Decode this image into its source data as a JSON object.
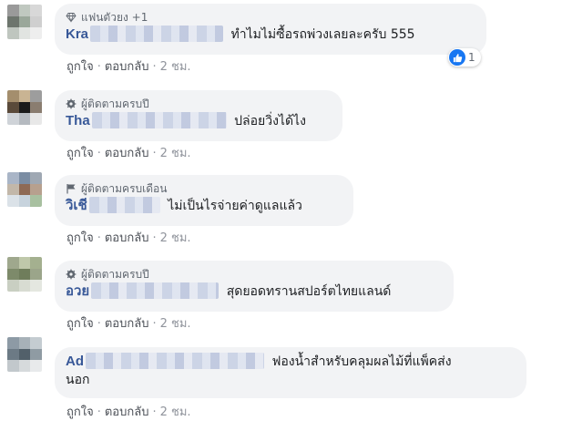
{
  "colors": {
    "author_link": "#385898",
    "bubble_bg": "#f2f3f5",
    "secondary_text": "#606770",
    "like_blue": "#1877f2"
  },
  "comments": [
    {
      "badge_icon": "diamond-icon",
      "badge_text": "แฟนตัวยง +1",
      "author_visible": "Kra",
      "body": "ทำไมไม่ซื้อรถพ่วงเลยละครับ 555",
      "actions": {
        "like": "ถูกใจ",
        "reply": "ตอบกลับ",
        "time": "2 ชม."
      },
      "reaction": {
        "icon": "like-icon",
        "count": "1"
      },
      "avatar_colors": [
        "#9a9a9a",
        "#c0c8c0",
        "#d8d8d8",
        "#6d756d",
        "#9aa79a",
        "#cfcfcf",
        "#bfc6bf",
        "#e1e4e1",
        "#eeeeee"
      ]
    },
    {
      "badge_icon": "gear-icon",
      "badge_text": "ผู้ติดตามครบปี",
      "author_visible": "Tha",
      "body": "ปล่อยวิ่งได้ไง",
      "actions": {
        "like": "ถูกใจ",
        "reply": "ตอบกลับ",
        "time": "2 ชม."
      },
      "avatar_colors": [
        "#a48e6d",
        "#c9b493",
        "#9d9d9d",
        "#5a4a3a",
        "#1a1a1a",
        "#8a7d70",
        "#cfd3d8",
        "#b5bac0",
        "#e8e8e8"
      ]
    },
    {
      "badge_icon": "flag-icon",
      "badge_text": "ผู้ติดตามครบเดือน",
      "author_visible": "วิเชี",
      "body": "ไม่เป็นไรจ่ายค่าดูแลแล้ว",
      "actions": {
        "like": "ถูกใจ",
        "reply": "ตอบกลับ",
        "time": "2 ชม."
      },
      "avatar_colors": [
        "#a9b5c7",
        "#7b8da3",
        "#9fa8b3",
        "#c2b7a9",
        "#8e6a55",
        "#b7a08e",
        "#dbe2e8",
        "#c7d3dd",
        "#a8c0a0"
      ]
    },
    {
      "badge_icon": "gear-icon",
      "badge_text": "ผู้ติดตามครบปี",
      "author_visible": "อวย",
      "body": "สุดยอดทรานสปอร์ตไทยแลนด์",
      "actions": {
        "like": "ถูกใจ",
        "reply": "ตอบกลับ",
        "time": "2 ชม."
      },
      "avatar_colors": [
        "#9fa88d",
        "#bfc8aa",
        "#a4b08f",
        "#7d8a6a",
        "#6f7d5b",
        "#9ba58a",
        "#c9cfc2",
        "#d8dcd2",
        "#e4e7e0"
      ]
    },
    {
      "badge_icon": "",
      "badge_text": "",
      "author_visible": "Ad",
      "body_line1": "ฟองน้ำสำหรับคลุมผลไม้ที่แพ็คส่ง",
      "body_line2": "นอก",
      "actions": {
        "like": "ถูกใจ",
        "reply": "ตอบกลับ",
        "time": "2 ชม."
      },
      "avatar_colors": [
        "#8d9aa5",
        "#a7b1b8",
        "#c4ccd1",
        "#6c7a85",
        "#52606a",
        "#8f9ba3",
        "#c2c8cc",
        "#d6dadc",
        "#e8eaeb"
      ]
    }
  ]
}
